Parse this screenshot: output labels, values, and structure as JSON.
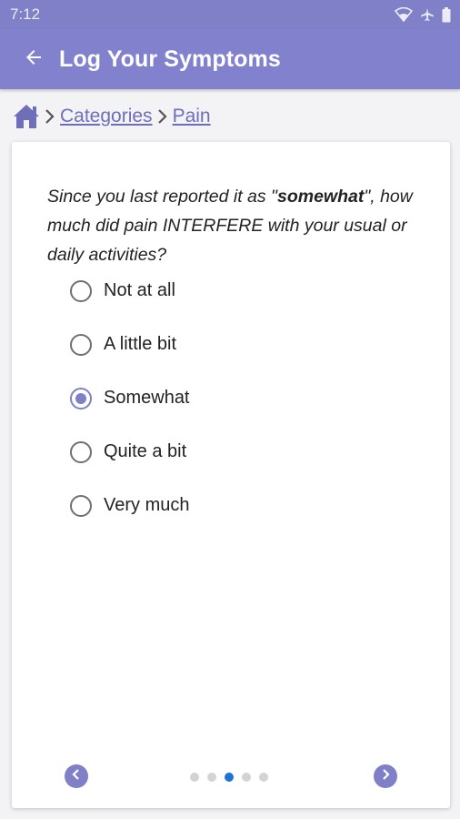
{
  "status_bar": {
    "time": "7:12",
    "icons": [
      "wifi-icon",
      "airplane-icon",
      "battery-icon"
    ]
  },
  "app_bar": {
    "title": "Log Your Symptoms",
    "back_icon": "arrow-left-icon"
  },
  "breadcrumb": {
    "home_icon": "home-icon",
    "items": [
      "Categories",
      "Pain"
    ]
  },
  "question": {
    "prefix": "Since you last reported it as \"",
    "emphasis": "somewhat",
    "suffix": "\", how much did pain INTERFERE with your usual or daily activities?"
  },
  "options": [
    {
      "label": "Not at all",
      "selected": false
    },
    {
      "label": "A little bit",
      "selected": false
    },
    {
      "label": "Somewhat",
      "selected": true
    },
    {
      "label": "Quite a bit",
      "selected": false
    },
    {
      "label": "Very much",
      "selected": false
    }
  ],
  "pager": {
    "page_count": 5,
    "current_page": 3,
    "prev_icon": "chevron-left-icon",
    "next_icon": "chevron-right-icon"
  },
  "colors": {
    "primary": "#8181cd",
    "status_bar": "#7f80c8",
    "link": "#6e6eb9",
    "active_dot": "#1e73d4",
    "inactive_dot": "#d3d3d3"
  }
}
